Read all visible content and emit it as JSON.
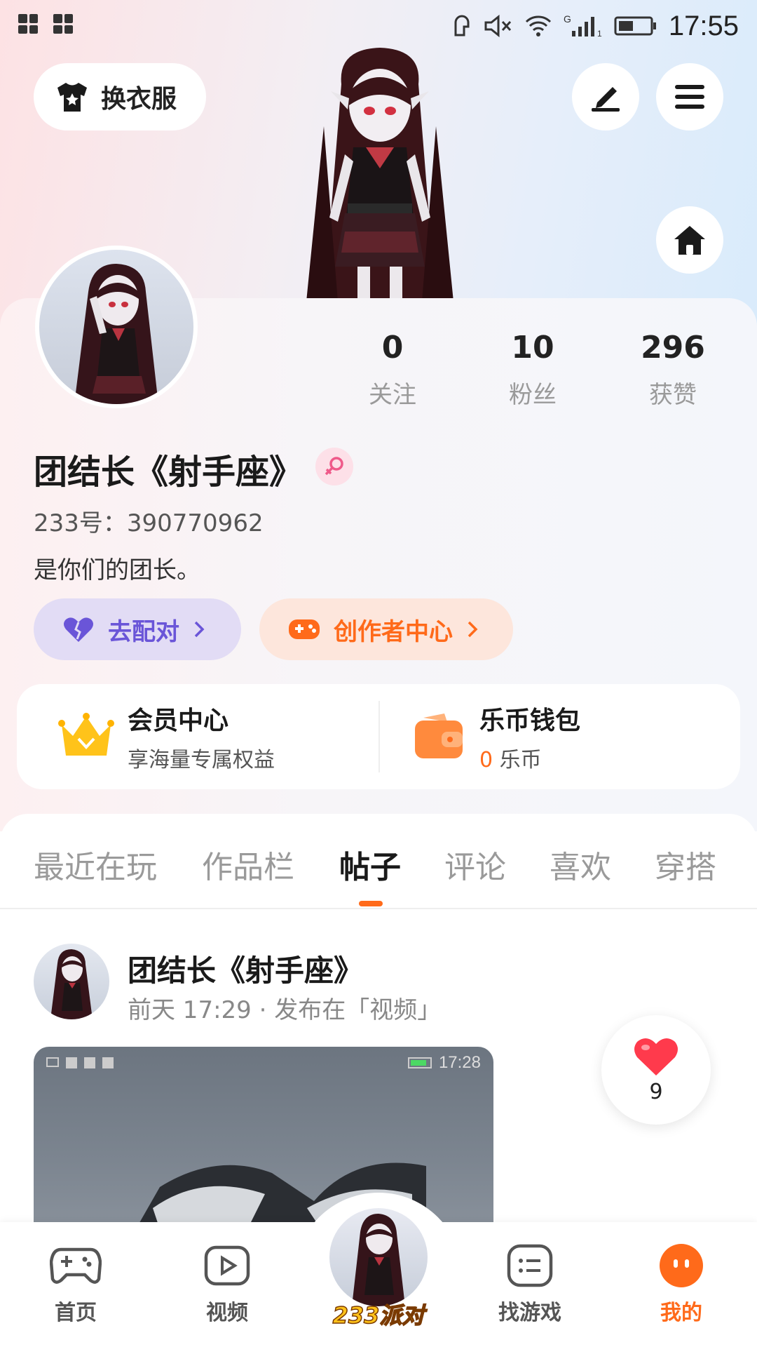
{
  "status_bar": {
    "time": "17:55"
  },
  "hero": {
    "outfit_label": "换衣服"
  },
  "stats": [
    {
      "value": "0",
      "label": "关注"
    },
    {
      "value": "10",
      "label": "粉丝"
    },
    {
      "value": "296",
      "label": "获赞"
    }
  ],
  "profile": {
    "nickname": "团结长《射手座》",
    "user_id": "233号：390770962",
    "bio": "是你们的团长。",
    "match_label": "去配对",
    "creator_label": "创作者中心"
  },
  "benefits": {
    "vip_title": "会员中心",
    "vip_sub": "享海量专属权益",
    "wallet_title": "乐币钱包",
    "wallet_amount": "0",
    "wallet_unit": "乐币"
  },
  "tabs": [
    "最近在玩",
    "作品栏",
    "帖子",
    "评论",
    "喜欢",
    "穿搭"
  ],
  "post": {
    "author": "团结长《射手座》",
    "meta": "前天 17:29 · 发布在「视频」",
    "media_time": "17:28",
    "likes": "9"
  },
  "bottom_nav": {
    "home": "首页",
    "video": "视频",
    "center": "233派对",
    "games": "找游戏",
    "mine": "我的"
  },
  "colors": {
    "accent": "#ff6a1a",
    "match": "#6a55d8"
  }
}
